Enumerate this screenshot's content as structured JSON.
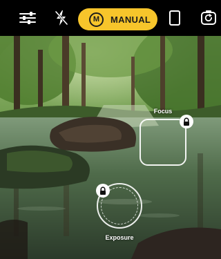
{
  "toolbar": {
    "mode": {
      "badge": "M",
      "label": "MANUAL",
      "color": "#f7c52b"
    },
    "icons": [
      "sliders-icon",
      "flash-off-icon",
      "aspect-ratio-icon",
      "camera-flip-icon"
    ]
  },
  "viewfinder": {
    "focus": {
      "label": "Focus",
      "locked": true
    },
    "exposure": {
      "label": "Exposure",
      "locked": true
    }
  }
}
